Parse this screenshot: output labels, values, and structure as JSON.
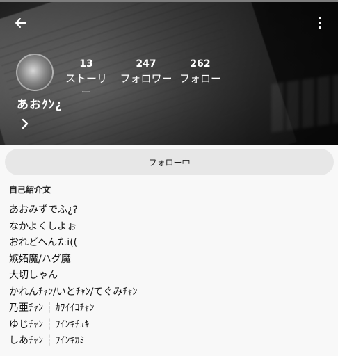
{
  "header": {
    "icons": {
      "back": "arrow-left-icon",
      "menu": "more-vertical-icon",
      "expand": "chevron-right-icon"
    },
    "stats": [
      {
        "count": "13",
        "label": "ストーリー"
      },
      {
        "count": "247",
        "label": "フォロワー"
      },
      {
        "count": "262",
        "label": "フォロー"
      }
    ],
    "username": "あおｸﾝ¿"
  },
  "follow_button": {
    "label": "フォロー中"
  },
  "bio": {
    "title": "自己紹介文",
    "lines": [
      "あおみずでふ¿?",
      "なかよくしよぉ",
      "おれどへんたi((",
      "嫉妬魔/ハグ魔",
      "大切しゃん",
      "かれんﾁｬﾝ/いとﾁｬﾝ/てぐみﾁｬﾝ",
      "乃亜ﾁｬﾝ ┆ ｶﾜｲｲｺﾁｬﾝ",
      "ゆじﾁｬﾝ ┆ ﾌｲﾝｷﾁｭｷ",
      "しあﾁｬﾝ ┆ ﾌｲﾝｷｶﾐ"
    ]
  },
  "colors": {
    "page_bg": "#f8f8f8",
    "button_bg": "#e7e7e7",
    "header_text": "#ffffff",
    "body_text": "#111111"
  }
}
